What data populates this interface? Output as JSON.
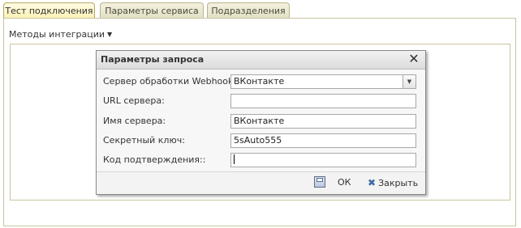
{
  "tabs": [
    {
      "label": "Тест подключения",
      "active": true
    },
    {
      "label": "Параметры сервиса",
      "active": false
    },
    {
      "label": "Подразделения",
      "active": false
    }
  ],
  "methods_menu": {
    "label": "Методы интеграции"
  },
  "dialog": {
    "title": "Параметры запроса",
    "fields": [
      {
        "label": "Сервер обработки Webhook:",
        "value": "ВКонтакте"
      },
      {
        "label": "URL сервера:",
        "value": ""
      },
      {
        "label": "Имя сервера:",
        "value": "ВКонтакте"
      },
      {
        "label": "Секретный ключ:",
        "value": "5sAuto555"
      },
      {
        "label": "Код подтверждения::",
        "value": ""
      }
    ],
    "ok_label": "ОК",
    "close_label": "Закрыть"
  },
  "icons": {
    "save": "save-icon",
    "close": "close-icon",
    "dropdown": "chevron-down-icon"
  }
}
